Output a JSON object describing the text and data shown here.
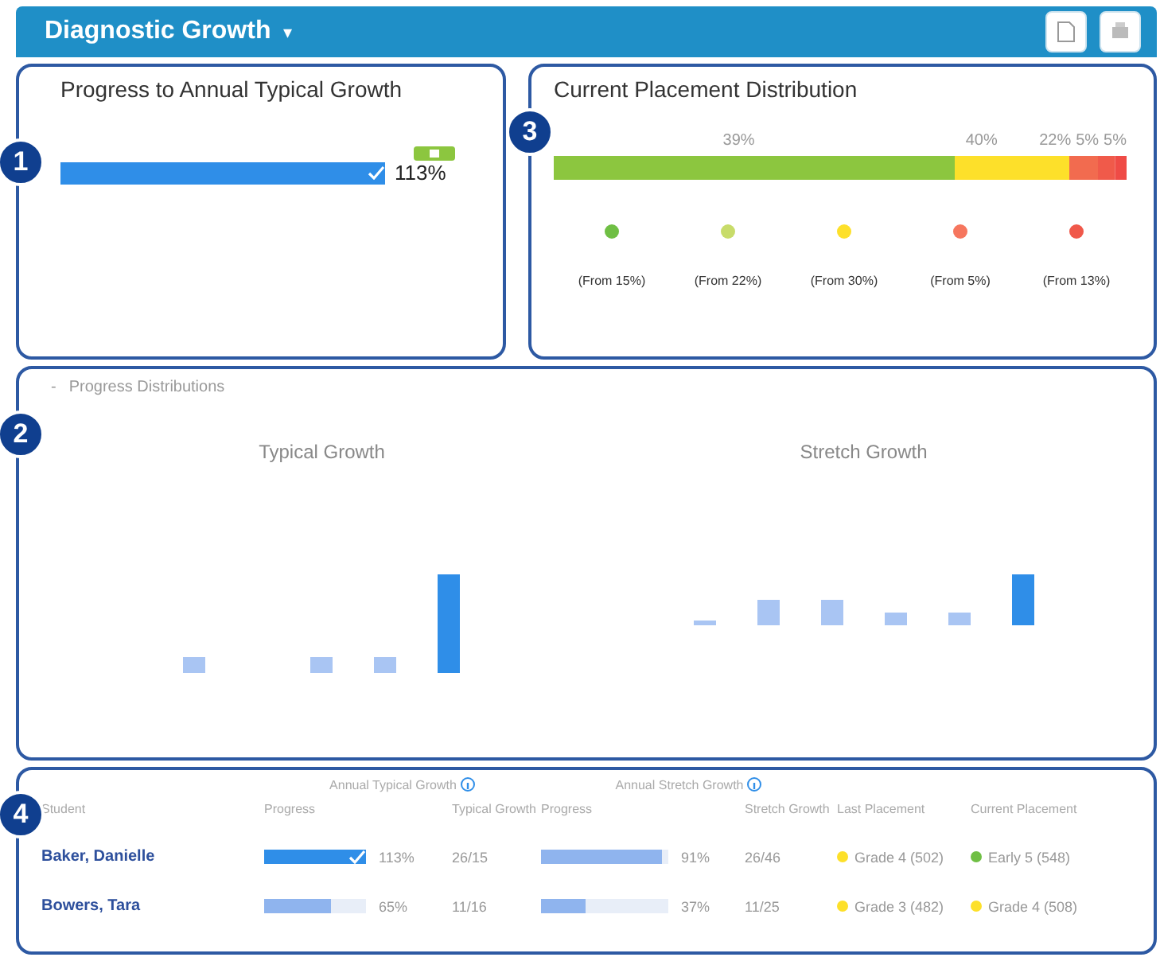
{
  "header": {
    "title": "Diagnostic Growth",
    "caret": "▾"
  },
  "callouts": [
    "1",
    "2",
    "3",
    "4"
  ],
  "typical_progress": {
    "title": "Progress to Annual Typical Growth",
    "level": 1,
    "checked": true,
    "reading": "113%"
  },
  "placement": {
    "title": "Current Placement Distribution",
    "bar_labels": [
      "39%",
      "40%",
      "22%",
      "5%",
      "5%"
    ],
    "legend": [
      {
        "label": "(From 15%)",
        "color": "#6fbf44"
      },
      {
        "label": "(From 22%)",
        "color": "#c8dc6a"
      },
      {
        "label": "(From 30%)",
        "color": "#fde02a"
      },
      {
        "label": "(From 5%)",
        "color": "#f6765e"
      },
      {
        "label": "(From 13%)",
        "color": "#f0584a"
      }
    ]
  },
  "distributions": {
    "title": "Progress Distributions",
    "toggle": "-",
    "charts": [
      {
        "title": "Typical Growth"
      },
      {
        "title": "Stretch Growth"
      }
    ]
  },
  "table": {
    "groups": [
      "Annual Typical Growth",
      "Annual Stretch Growth"
    ],
    "columns": [
      "Student",
      "Progress",
      "Typical Growth",
      "Progress",
      "Stretch Growth",
      "Last Placement",
      "Current Placement"
    ],
    "rows": [
      {
        "student": "Baker, Danielle",
        "typical": {
          "level": 1,
          "checked": true,
          "reading": "113%"
        },
        "typical_growth": "26/15",
        "stretch": {
          "level": 0.95,
          "reading": "91%"
        },
        "stretch_growth": "26/46",
        "last": {
          "text": "Grade 4 (502)",
          "color": "#fde02a"
        },
        "current": {
          "text": "Early 5 (548)",
          "color": "#6fbf44"
        }
      },
      {
        "student": "Bowers, Tara",
        "typical": {
          "level": 0.65,
          "checked": false,
          "reading": "65%"
        },
        "typical_growth": "11/16",
        "stretch": {
          "level": 0.35,
          "reading": "37%"
        },
        "stretch_growth": "11/25",
        "last": {
          "text": "Grade 3 (482)",
          "color": "#fde02a"
        },
        "current": {
          "text": "Grade 4 (508)",
          "color": "#fde02a"
        }
      }
    ]
  }
}
